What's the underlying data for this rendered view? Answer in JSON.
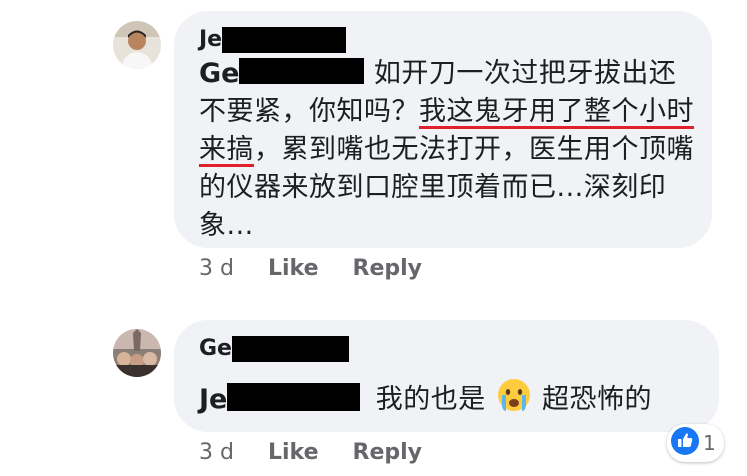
{
  "comments": [
    {
      "author_visible": "Je",
      "mention_visible": "Ge",
      "text_part1": "如开刀一次过把牙拔出还不要紧，你知吗？",
      "text_underlined": "我这鬼牙用了整个小时来搞",
      "text_part2": "，累到嘴也无法打开，医生用个顶嘴的仪器来放到口腔里顶着而已...深刻印象...",
      "time": "3 d",
      "like_label": "Like",
      "reply_label": "Reply"
    },
    {
      "author_visible": "Ge",
      "mention_visible": "Je",
      "text_part1": "我的也是",
      "emoji": "crying-face-emoji",
      "text_part2": "超恐怖的",
      "time": "3 d",
      "like_label": "Like",
      "reply_label": "Reply",
      "reaction": {
        "icon": "thumbs-up-icon",
        "count": "1"
      }
    }
  ],
  "colors": {
    "bubble": "#f0f2f5",
    "action_text": "#65676b",
    "underline": "#e0202a",
    "like_blue": "#1877f2"
  }
}
